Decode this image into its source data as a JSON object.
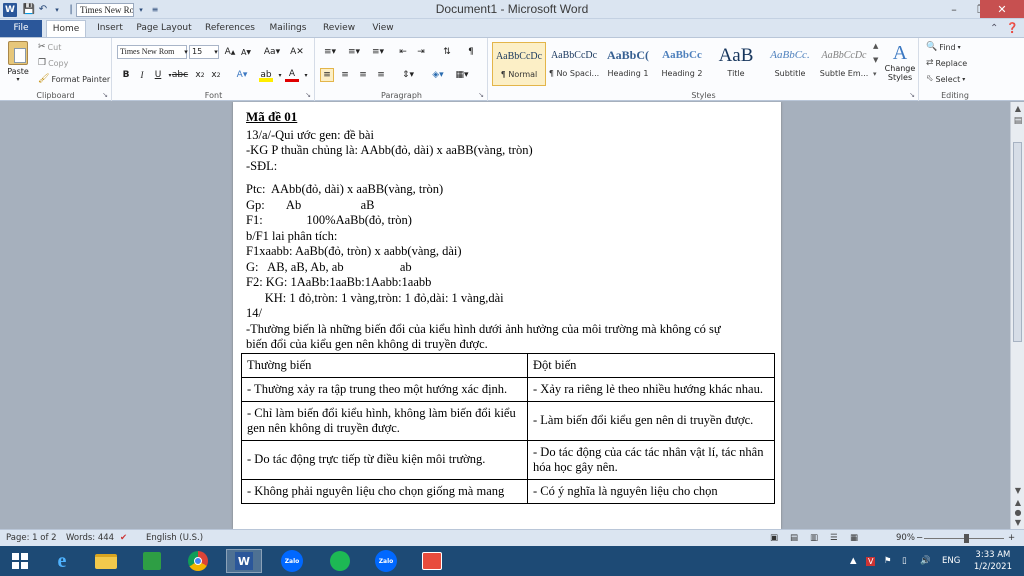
{
  "window": {
    "title": "Document1  -  Microsoft Word",
    "quick_access_font": "Times New Ro",
    "colors": {
      "file_tab": "#2b579a",
      "taskbar": "#1d4a75",
      "close": "#c75050"
    }
  },
  "tabs": [
    "File",
    "Home",
    "Insert",
    "Page Layout",
    "References",
    "Mailings",
    "Review",
    "View"
  ],
  "clipboard": {
    "paste": "Paste",
    "cut": "Cut",
    "copy": "Copy",
    "format_painter": "Format Painter",
    "label": "Clipboard"
  },
  "font": {
    "name": "Times New Rom",
    "size": "15",
    "label": "Font"
  },
  "paragraph": {
    "label": "Paragraph"
  },
  "styles": {
    "label": "Styles",
    "items": [
      {
        "preview": "AaBbCcDc",
        "name": "¶ Normal"
      },
      {
        "preview": "AaBbCcDc",
        "name": "¶ No Spaci..."
      },
      {
        "preview": "AaBbC(",
        "name": "Heading 1"
      },
      {
        "preview": "AaBbCc",
        "name": "Heading 2"
      },
      {
        "preview": "AaB",
        "name": "Title"
      },
      {
        "preview": "AaBbCc.",
        "name": "Subtitle"
      },
      {
        "preview": "AaBbCcDc",
        "name": "Subtle Em..."
      }
    ],
    "change_styles": "Change Styles",
    "change_styles_line1": "Change",
    "change_styles_line2": "Styles"
  },
  "editing": {
    "find": "Find",
    "replace": "Replace",
    "select": "Select",
    "label": "Editing"
  },
  "document": {
    "heading": "Mã đề 01",
    "lines": [
      "13/a/-Qui ước gen: đề bài",
      "-KG P thuần chủng là: AAbb(đỏ, dài) x aaBB(vàng, tròn)",
      "-SĐL:",
      "Ptc:  AAbb(đỏ, dài) x aaBB(vàng, tròn)",
      "Gp:       Ab                   aB",
      "F1:              100%AaBb(đỏ, tròn)",
      "b/F1 lai phân tích:",
      "F1xaabb: AaBb(đỏ, tròn) x aabb(vàng, dài)",
      "G:   AB, aB, Ab, ab                  ab",
      "F2: KG: 1AaBb:1aaBb:1Aabb:1aabb",
      "      KH: 1 đỏ,tròn: 1 vàng,tròn: 1 đỏ,dài: 1 vàng,dài",
      "14/",
      "-Thường biến là những biến đổi của kiểu hình dưới ảnh hưởng của môi trường mà không có sự",
      "biến đổi của kiểu gen nên không di truyền được."
    ],
    "table": {
      "headers": [
        "Thường biến",
        "Đột biến"
      ],
      "rows": [
        [
          "- Thường xảy ra tập trung theo một hướng xác định.",
          "- Xảy ra riêng lẻ theo nhiều hướng khác nhau."
        ],
        [
          "- Chỉ làm biến đổi kiểu hình, không làm biến đổi kiểu gen nên không di truyền được.",
          "- Làm biến đổi kiểu gen nên di truyền được."
        ],
        [
          "- Do tác động trực tiếp từ điều kiện môi trường.",
          "- Do tác động của các tác nhân vật lí, tác nhân hóa học gây nên."
        ],
        [
          "- Không phải nguyên liệu cho chọn giống mà mang",
          "- Có ý nghĩa là nguyên liệu cho chọn"
        ]
      ]
    }
  },
  "status": {
    "page": "Page: 1 of 2",
    "words": "Words: 444",
    "language": "English (U.S.)",
    "zoom": "90%"
  },
  "taskbar": {
    "language": "ENG",
    "time": "3:33 AM",
    "date": "1/2/2021"
  }
}
